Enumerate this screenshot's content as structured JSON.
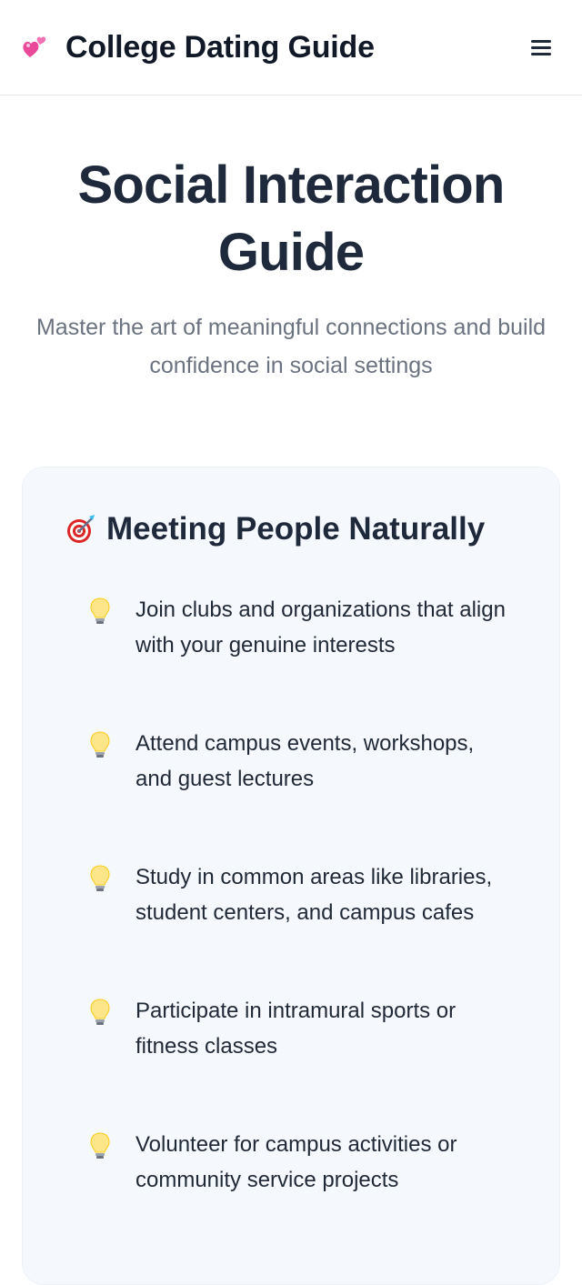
{
  "header": {
    "brand_icon": "two-hearts-icon",
    "title": "College Dating Guide",
    "menu_icon": "hamburger-menu-icon"
  },
  "hero": {
    "title": "Social Interaction Guide",
    "subtitle": "Master the art of meaningful connections and build confidence in social settings"
  },
  "section": {
    "icon": "target-icon",
    "title": "Meeting People Naturally",
    "tips": [
      "Join clubs and organizations that align with your genuine interests",
      "Attend campus events, workshops, and guest lectures",
      "Study in common areas like libraries, student centers, and campus cafes",
      "Participate in intramural sports or fitness classes",
      "Volunteer for campus activities or community service projects"
    ],
    "tip_icon": "lightbulb-icon"
  },
  "colors": {
    "heading": "#1e293b",
    "muted": "#6b7280",
    "card_background": "#f5f8fc",
    "accent_pink": "#ec4899"
  }
}
